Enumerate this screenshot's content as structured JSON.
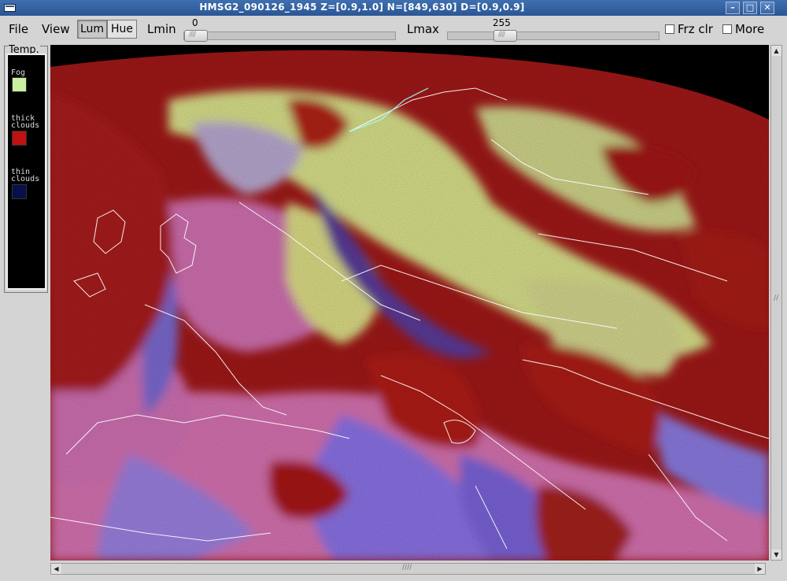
{
  "window": {
    "title": "HMSG2_090126_1945  Z=[0.9,1.0]  N=[849,630]  D=[0.9,0.9]",
    "minimize": "–",
    "maximize": "□",
    "close": "✕"
  },
  "toolbar": {
    "menu_file": "File",
    "menu_view": "View",
    "lum_label": "Lum",
    "hue_label": "Hue",
    "lmin_label": "Lmin",
    "lmin_value": "0",
    "lmax_label": "Lmax",
    "lmax_value": "255",
    "frz_label": "Frz clr",
    "more_label": "More",
    "lum_pressed": true
  },
  "legend": {
    "title": "Temp.",
    "items": [
      {
        "label": "Fog",
        "color": "#c8f0a0"
      },
      {
        "label": "thick\nclouds",
        "color": "#c01010"
      },
      {
        "label": "thin\nclouds",
        "color": "#08104a"
      }
    ]
  },
  "image": {
    "description_colors": {
      "space": "#000000",
      "thick_clouds": "#a01818",
      "fog": "#d8e08a",
      "thin_clouds": "#8870e0",
      "land": "#d070a8",
      "border_lines": "#ffffff"
    }
  },
  "colors": {
    "titlebar": "#2a5694",
    "panel_bg": "#d4d4d4"
  }
}
